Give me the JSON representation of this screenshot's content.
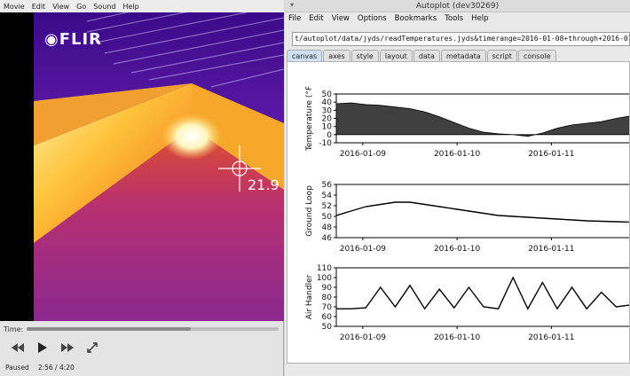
{
  "player": {
    "menu": [
      "Movie",
      "Edit",
      "View",
      "Go",
      "Sound",
      "Help"
    ],
    "logo_text": "◉FLIR",
    "temperature_readout": "21.9",
    "time_label": "Time:",
    "playback_fraction": 0.65,
    "status": "Paused",
    "position": "2:56 / 4:20"
  },
  "autoplot": {
    "window_title": "Autoplot (dev30269)",
    "menu": [
      "File",
      "Edit",
      "View",
      "Options",
      "Bookmarks",
      "Tools",
      "Help"
    ],
    "uri": "t/autoplot/data/jyds/readTemperatures.jyds&timerange=2016-01-08+through+2016-01-11",
    "tabs": [
      "canvas",
      "axes",
      "style",
      "layout",
      "data",
      "metadata",
      "script",
      "console"
    ],
    "active_tab": "canvas"
  },
  "chart_data": [
    {
      "type": "area",
      "ylabel": "Temperature (°F",
      "ylim": [
        -10,
        50
      ],
      "yticks": [
        "50",
        "40",
        "30",
        "20",
        "10",
        "0",
        "-10"
      ],
      "x_tick_labels": [
        "2016-01-09",
        "2016-01-10",
        "2016-01-11"
      ],
      "x": [
        0,
        0.05,
        0.1,
        0.15,
        0.2,
        0.25,
        0.3,
        0.35,
        0.4,
        0.45,
        0.5,
        0.55,
        0.6,
        0.65,
        0.7,
        0.75,
        0.8,
        0.85,
        0.9,
        0.95,
        1.0
      ],
      "values": [
        38,
        39,
        37,
        36,
        34,
        32,
        28,
        22,
        15,
        8,
        3,
        1,
        0,
        -2,
        2,
        8,
        12,
        14,
        16,
        20,
        23
      ]
    },
    {
      "type": "line",
      "ylabel": "Ground Loop",
      "ylim": [
        45,
        57
      ],
      "yticks": [
        "56",
        "54",
        "52",
        "50",
        "48",
        "46"
      ],
      "x_tick_labels": [
        "2016-01-09",
        "2016-01-10",
        "2016-01-11"
      ],
      "x": [
        0,
        0.05,
        0.1,
        0.15,
        0.2,
        0.25,
        0.3,
        0.35,
        0.4,
        0.45,
        0.5,
        0.55,
        0.6,
        0.65,
        0.7,
        0.75,
        0.8,
        0.85,
        0.9,
        0.95,
        1.0
      ],
      "values": [
        50,
        51,
        52,
        52.5,
        53,
        53,
        52.5,
        52,
        51.5,
        51,
        50.5,
        50,
        49.8,
        49.6,
        49.4,
        49.2,
        49,
        48.8,
        48.7,
        48.6,
        48.5
      ]
    },
    {
      "type": "line",
      "ylabel": "Air Handler",
      "ylim": [
        50,
        110
      ],
      "yticks": [
        "110",
        "100",
        "90",
        "80",
        "70",
        "60",
        "50"
      ],
      "x_tick_labels": [
        "2016-01-09",
        "2016-01-10",
        "2016-01-11"
      ],
      "x": [
        0,
        0.05,
        0.1,
        0.15,
        0.2,
        0.25,
        0.3,
        0.35,
        0.4,
        0.45,
        0.5,
        0.55,
        0.6,
        0.65,
        0.7,
        0.75,
        0.8,
        0.85,
        0.9,
        0.95,
        1.0
      ],
      "values": [
        68,
        68,
        69,
        90,
        70,
        92,
        68,
        88,
        69,
        90,
        70,
        68,
        100,
        68,
        95,
        68,
        90,
        68,
        85,
        70,
        72
      ]
    }
  ]
}
